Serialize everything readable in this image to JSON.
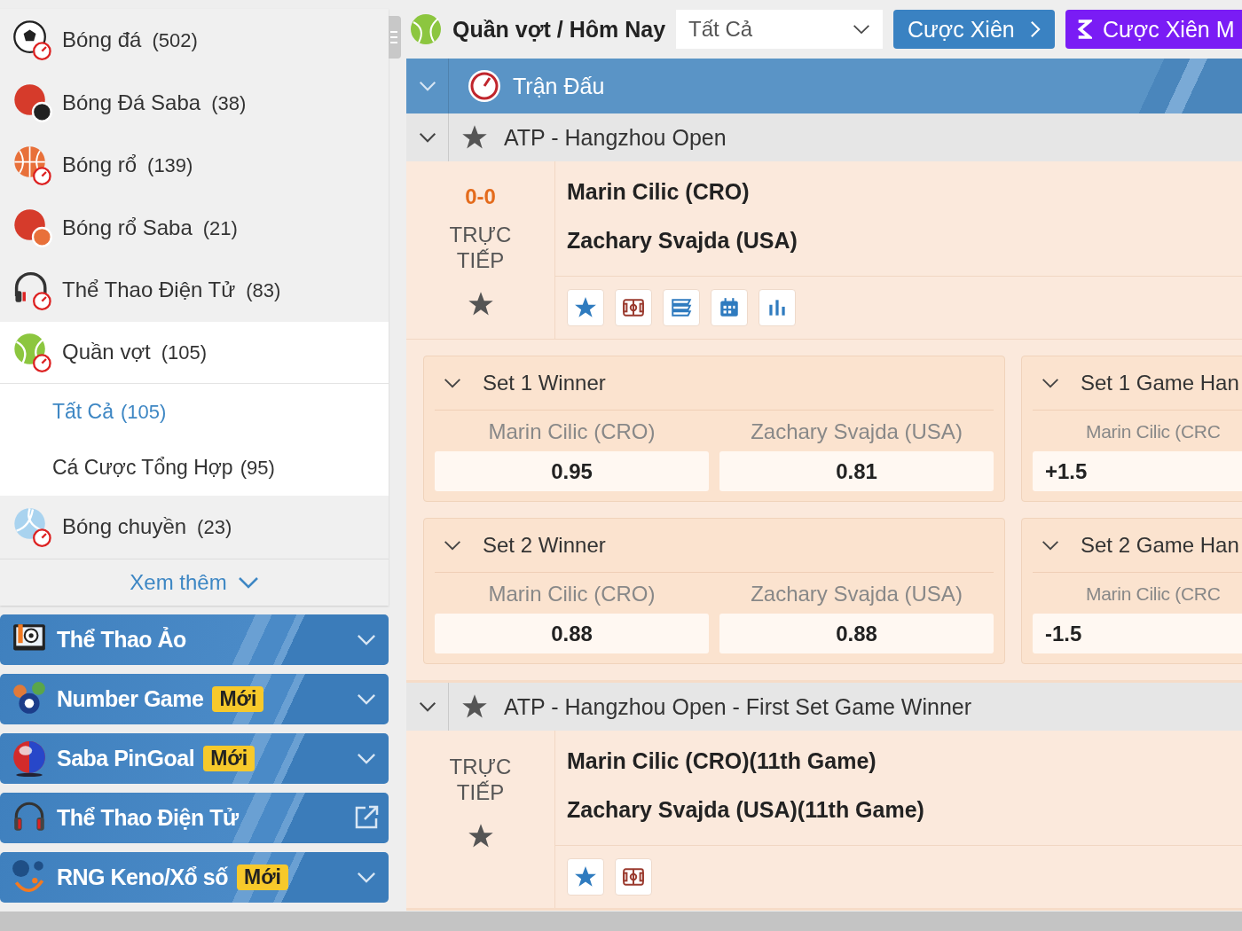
{
  "sidebar": {
    "sports": [
      {
        "name": "Bóng đá",
        "count": "(502)",
        "selected": false
      },
      {
        "name": "Bóng Đá Saba",
        "count": "(38)",
        "selected": false
      },
      {
        "name": "Bóng rổ",
        "count": "(139)",
        "selected": false
      },
      {
        "name": "Bóng rổ Saba",
        "count": "(21)",
        "selected": false
      },
      {
        "name": "Thể Thao Điện Tử",
        "count": "(83)",
        "selected": false
      },
      {
        "name": "Quần vợt",
        "count": "(105)",
        "selected": true,
        "expanded": true,
        "children": [
          {
            "name": "Tất Cả",
            "count": "(105)",
            "selected": true
          },
          {
            "name": "Cá Cược Tổng Hợp",
            "count": "(95)",
            "selected": false
          }
        ]
      },
      {
        "name": "Bóng chuyền",
        "count": "(23)",
        "selected": false
      }
    ],
    "more": "Xem thêm",
    "panels": [
      {
        "title": "Thể Thao Ảo",
        "kind": "dropdown"
      },
      {
        "title": "Number Game",
        "badge": "Mới",
        "kind": "dropdown"
      },
      {
        "title": "Saba PinGoal",
        "badge": "Mới",
        "kind": "dropdown"
      },
      {
        "title": "Thể Thao Điện Tử",
        "kind": "external"
      },
      {
        "title": "RNG Keno/Xổ số",
        "badge": "Mới",
        "kind": "dropdown"
      }
    ]
  },
  "header": {
    "breadcrumb": "Quần vợt / Hôm Nay",
    "filter": "Tất Cả",
    "buttons": [
      {
        "label": "Cược Xiên",
        "kind": "parlay"
      },
      {
        "label": "Cược Xiên M",
        "kind": "mix"
      }
    ]
  },
  "section": {
    "title": "Trận Đấu",
    "expanded": true
  },
  "leagues": [
    {
      "name": "ATP - Hangzhou Open",
      "expanded": true,
      "favorite": false,
      "matches": [
        {
          "score": "0-0",
          "status": "TRỰC TIẾP",
          "favorite": false,
          "teams": [
            "Marin Cilic (CRO)",
            "Zachary Svajda (USA)"
          ],
          "tools": [
            {
              "kind": "favorite"
            },
            {
              "kind": "field"
            },
            {
              "kind": "ticket"
            },
            {
              "kind": "calendar"
            },
            {
              "kind": "stats"
            }
          ],
          "markets": [
            {
              "title": "Set 1 Winner",
              "kind": "winner",
              "expanded": true,
              "columns": [
                "Marin Cilic (CRO)",
                "Zachary Svajda (USA)"
              ],
              "odds": [
                "0.95",
                "0.81"
              ]
            },
            {
              "title": "Set 1 Game Han",
              "kind": "handicap",
              "expanded": true,
              "columns": [
                "Marin Cilic (CRC"
              ],
              "odds": [
                "+1.5"
              ]
            },
            {
              "title": "Set 2 Winner",
              "kind": "winner",
              "expanded": true,
              "columns": [
                "Marin Cilic (CRO)",
                "Zachary Svajda (USA)"
              ],
              "odds": [
                "0.88",
                "0.88"
              ]
            },
            {
              "title": "Set 2 Game Han",
              "kind": "handicap",
              "expanded": true,
              "columns": [
                "Marin Cilic (CRC"
              ],
              "odds": [
                "-1.5"
              ]
            }
          ]
        }
      ]
    },
    {
      "name": "ATP - Hangzhou Open - First Set Game Winner",
      "expanded": true,
      "favorite": false,
      "matches": [
        {
          "status": "TRỰC TIẾP",
          "favorite": false,
          "teams": [
            "Marin Cilic (CRO)(11th Game)",
            "Zachary Svajda (USA)(11th Game)"
          ],
          "tools": [
            {
              "kind": "favorite"
            },
            {
              "kind": "field"
            }
          ]
        }
      ]
    }
  ]
}
